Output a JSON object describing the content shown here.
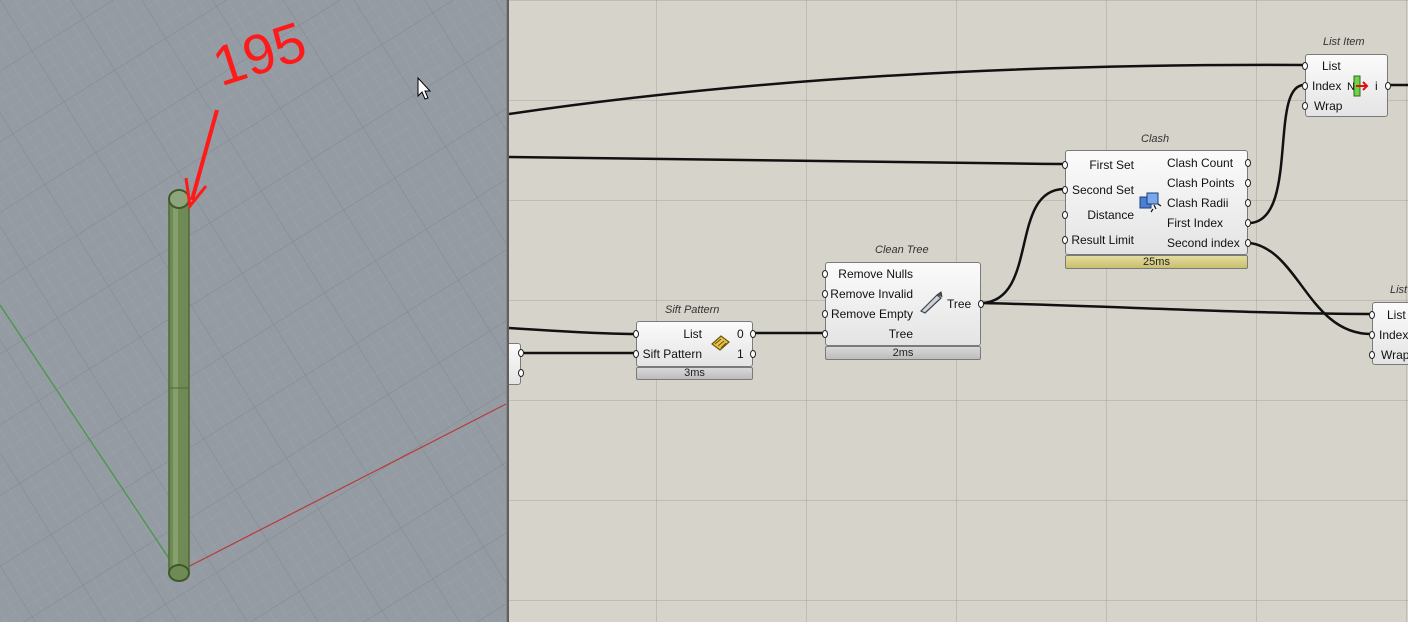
{
  "viewport": {
    "annotation": "195"
  },
  "components": {
    "sift_pattern": {
      "title": "Sift Pattern",
      "inputs": [
        "List",
        "Sift Pattern"
      ],
      "outputs": [
        "0",
        "1"
      ],
      "timing": "3ms"
    },
    "clean_tree": {
      "title": "Clean Tree",
      "inputs": [
        "Remove Nulls",
        "Remove Invalid",
        "Remove Empty",
        "Tree"
      ],
      "outputs": [
        "Tree"
      ],
      "timing": "2ms"
    },
    "clash": {
      "title": "Clash",
      "inputs": [
        "First Set",
        "Second Set",
        "Distance",
        "Result Limit"
      ],
      "outputs": [
        "Clash Count",
        "Clash Points",
        "Clash Radii",
        "First Index",
        "Second index"
      ],
      "timing": "25ms"
    },
    "list_item_1": {
      "title": "List Item",
      "inputs": [
        "List",
        "Index",
        "Wrap"
      ],
      "outputs": [
        "i"
      ]
    },
    "list_item_2": {
      "title": "List",
      "inputs": [
        "List",
        "Index",
        "Wrap"
      ]
    }
  },
  "colors": {
    "viewport_bg": "#959ba3",
    "canvas_bg": "#d6d3cb",
    "annotation": "#ff1a1a",
    "x_axis": "#b83a3a",
    "y_axis": "#3f9a3f",
    "column": "#6f8a55",
    "warn_bar": "#d4cc84"
  }
}
